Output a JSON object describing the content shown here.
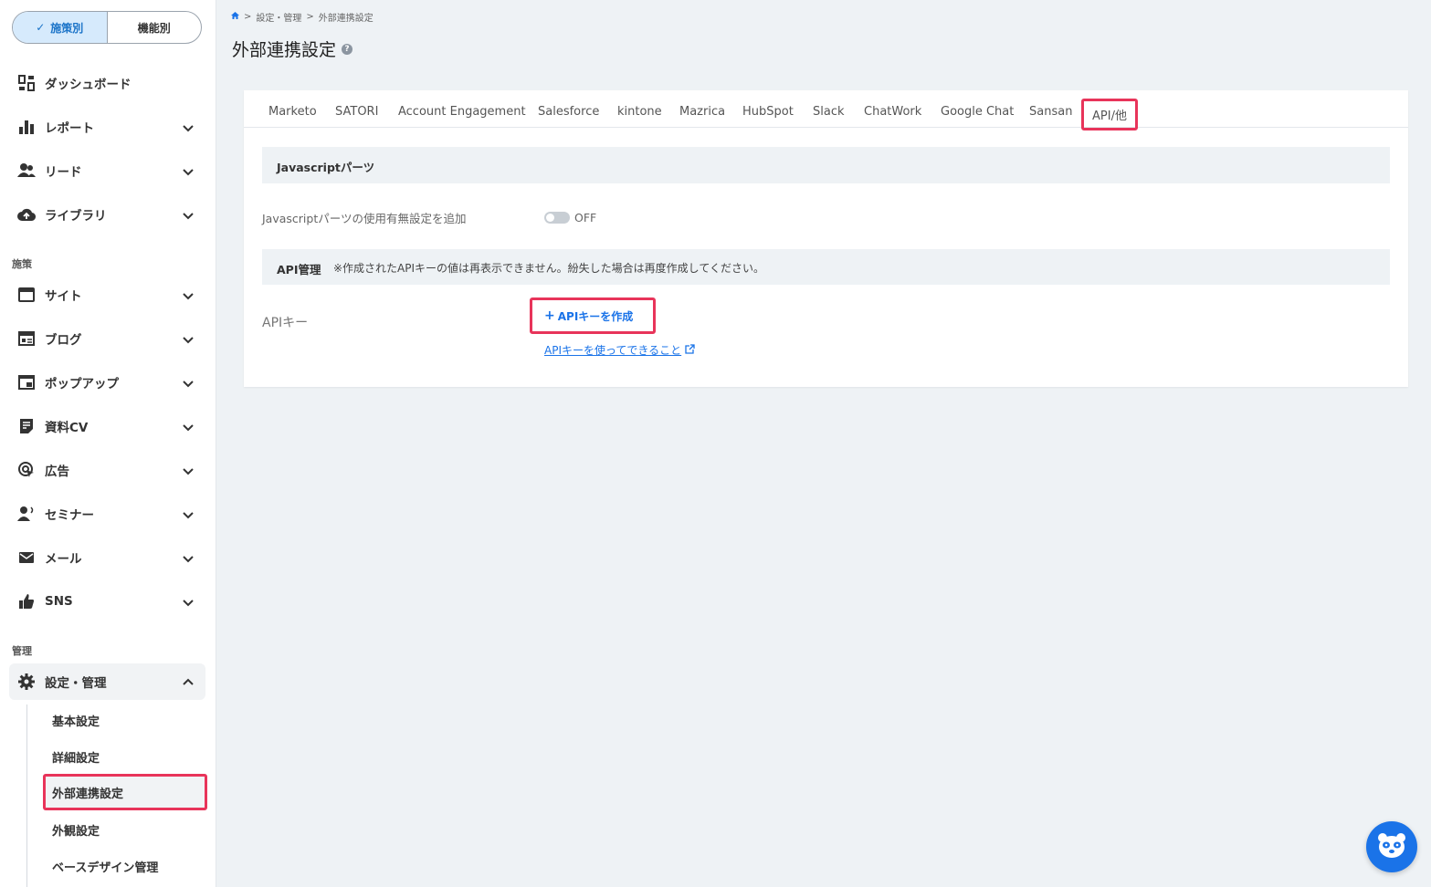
{
  "sidebar": {
    "view_toggle": {
      "active": "施策別",
      "inactive": "機能別"
    },
    "main_items": [
      {
        "label": "ダッシュボード",
        "icon": "dashboard-icon"
      },
      {
        "label": "レポート",
        "icon": "bar-chart-icon"
      },
      {
        "label": "リード",
        "icon": "people-icon"
      },
      {
        "label": "ライブラリ",
        "icon": "cloud-upload-icon"
      }
    ],
    "section_measures": "施策",
    "measure_items": [
      {
        "label": "サイト",
        "icon": "browser-icon"
      },
      {
        "label": "ブログ",
        "icon": "blog-icon"
      },
      {
        "label": "ポップアップ",
        "icon": "popup-icon"
      },
      {
        "label": "資料CV",
        "icon": "document-icon"
      },
      {
        "label": "広告",
        "icon": "target-cursor-icon"
      },
      {
        "label": "セミナー",
        "icon": "speaker-icon"
      },
      {
        "label": "メール",
        "icon": "mail-icon"
      },
      {
        "label": "SNS",
        "icon": "thumbs-up-icon"
      }
    ],
    "section_admin": "管理",
    "admin_item": {
      "label": "設定・管理",
      "icon": "gear-icon"
    },
    "admin_sub_items": [
      "基本設定",
      "詳細設定",
      "外部連携設定",
      "外観設定",
      "ベースデザイン管理"
    ],
    "active_sub_item": "外部連携設定"
  },
  "breadcrumb": {
    "items": [
      "設定・管理",
      "外部連携設定"
    ],
    "separator": ">"
  },
  "page": {
    "title": "外部連携設定"
  },
  "tabs": [
    "Marketo",
    "SATORI",
    "Account Engagement",
    "Salesforce",
    "kintone",
    "Mazrica",
    "HubSpot",
    "Slack",
    "ChatWork",
    "Google Chat",
    "Sansan",
    "API/他"
  ],
  "active_tab": "API/他",
  "js_section": {
    "title": "Javascriptパーツ",
    "setting_label": "Javascriptパーツの使用有無設定を追加",
    "toggle_state": "OFF"
  },
  "api_section": {
    "title": "API管理",
    "note": "※作成されたAPIキーの値は再表示できません。紛失した場合は再度作成してください。",
    "key_label": "APIキー",
    "create_button": "APIキーを作成",
    "help_link": "APIキーを使ってできること"
  },
  "colors": {
    "accent": "#1a73e8",
    "highlight": "#e8345a",
    "background": "#eef2f5"
  }
}
